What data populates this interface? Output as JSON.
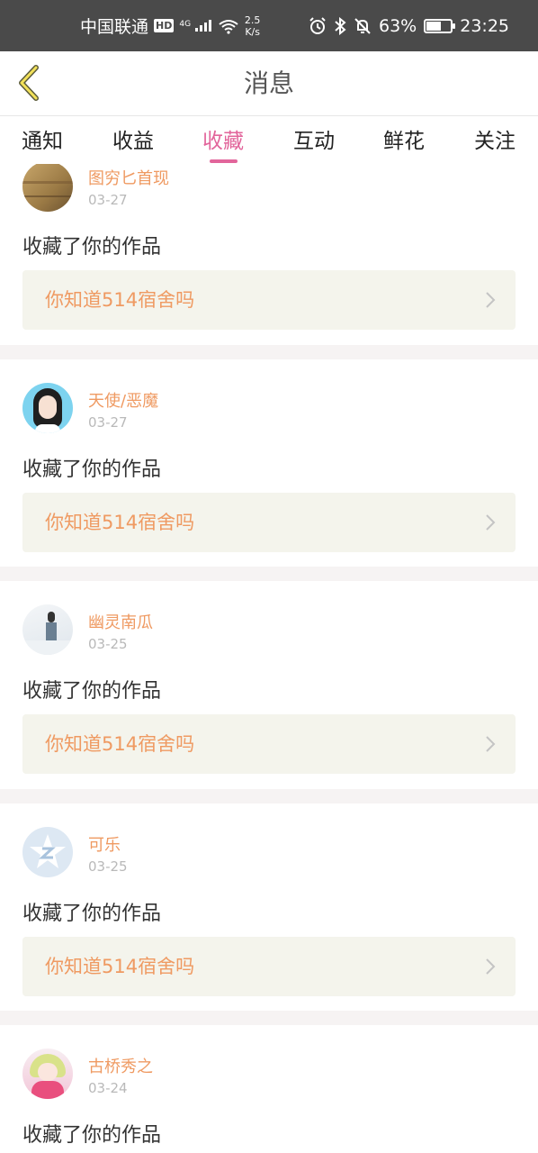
{
  "status_bar": {
    "carrier": "中国联通",
    "hd": "HD",
    "signal": "4G",
    "speed_value": "2.5",
    "speed_unit": "K/s",
    "battery": "63%",
    "battery_level": 0.63,
    "time": "23:25",
    "icons": [
      "alarm-icon",
      "bluetooth-icon",
      "mute-icon",
      "battery-icon",
      "wifi-icon"
    ]
  },
  "header": {
    "title": "消息",
    "back_icon": "chevron-left-icon"
  },
  "tabs": [
    {
      "label": "通知"
    },
    {
      "label": "收益"
    },
    {
      "label": "收藏",
      "active": true
    },
    {
      "label": "互动"
    },
    {
      "label": "鲜花"
    },
    {
      "label": "关注"
    }
  ],
  "notifications": [
    {
      "name": "图穷匕首现",
      "date": "03-27",
      "action": "收藏了你的作品",
      "work": "你知道514宿舍吗",
      "avatar": "wood-texture-avatar"
    },
    {
      "name": "天使/恶魔",
      "date": "03-27",
      "action": "收藏了你的作品",
      "work": "你知道514宿舍吗",
      "avatar": "girl-cartoon-avatar"
    },
    {
      "name": "幽灵南瓜",
      "date": "03-25",
      "action": "收藏了你的作品",
      "work": "你知道514宿舍吗",
      "avatar": "figure-photo-avatar"
    },
    {
      "name": "可乐",
      "date": "03-25",
      "action": "收藏了你的作品",
      "work": "你知道514宿舍吗",
      "avatar": "default-star-avatar"
    },
    {
      "name": "古桥秀之",
      "date": "03-24",
      "action": "收藏了你的作品",
      "work": "",
      "avatar": "anime-girl-avatar"
    }
  ],
  "colors": {
    "accent": "#e2659b",
    "name": "#ef9a62",
    "date": "#b9b9b9",
    "card_bg": "#f4f4ec",
    "separator": "#f6f3f3",
    "status_bar": "#4a4a4a"
  }
}
